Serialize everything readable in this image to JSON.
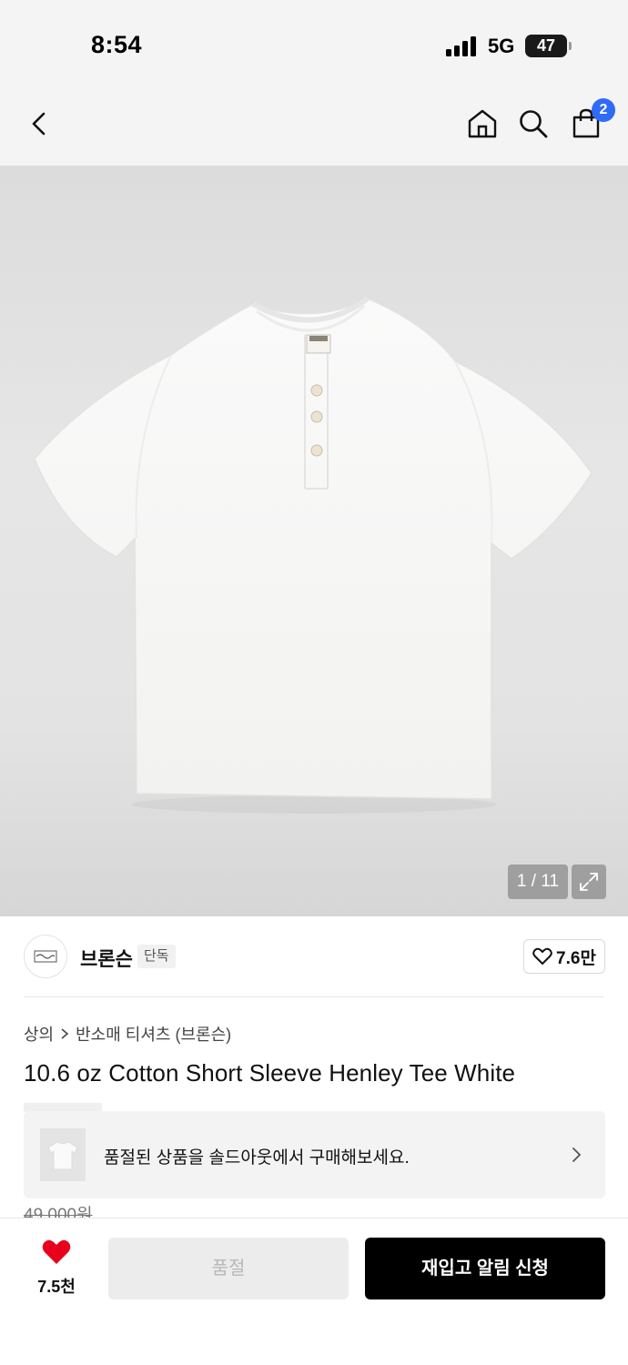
{
  "status_bar": {
    "time": "8:54",
    "network": "5G",
    "battery": "47"
  },
  "header": {
    "back_icon": "chevron-left-icon",
    "home_icon": "home-icon",
    "search_icon": "search-icon",
    "bag_icon": "shopping-bag-icon",
    "bag_badge": "2",
    "badge_color": "#2f6bf5"
  },
  "gallery": {
    "counter": "1 / 11",
    "expand_icon": "expand-icon"
  },
  "brand": {
    "name": "브론슨",
    "tag": "단독",
    "likes": "7.6만"
  },
  "breadcrumb": {
    "category": "상의",
    "subcategory": "반소매 티셔츠 (브론슨)"
  },
  "product": {
    "title": "10.6 oz Cotton Short Sleeve Henley Tee White",
    "price_original": "49,000원"
  },
  "banner": {
    "text": "품절된 상품을 솔드아웃에서 구매해보세요."
  },
  "bottom_bar": {
    "wish_count": "7.5천",
    "wish_color": "#e8001c",
    "soldout_label": "품절",
    "restock_label": "재입고 알림 신청"
  }
}
